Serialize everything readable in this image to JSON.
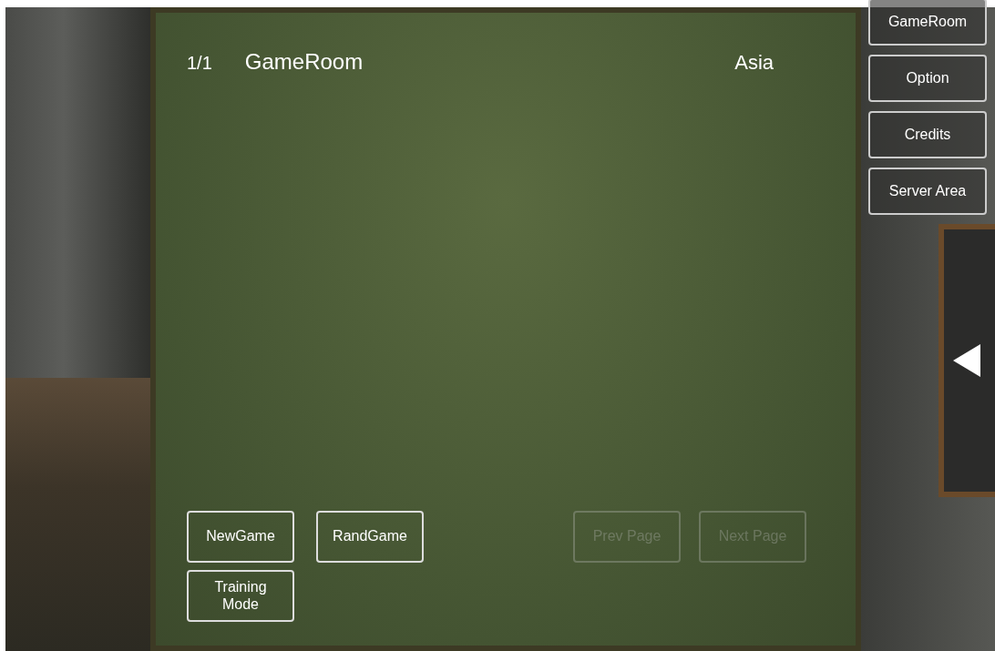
{
  "board": {
    "page": "1/1",
    "title": "GameRoom",
    "region": "Asia",
    "actions": [
      {
        "label": "NewGame",
        "disabled": false
      },
      {
        "label": "RandGame",
        "disabled": false
      },
      {
        "label": "Training Mode",
        "disabled": false
      }
    ],
    "paging": [
      {
        "label": "Prev Page",
        "disabled": true
      },
      {
        "label": "Next Page",
        "disabled": true
      }
    ]
  },
  "menu": [
    {
      "label": "GameRoom"
    },
    {
      "label": "Option"
    },
    {
      "label": "Credits"
    },
    {
      "label": "Server Area"
    }
  ]
}
